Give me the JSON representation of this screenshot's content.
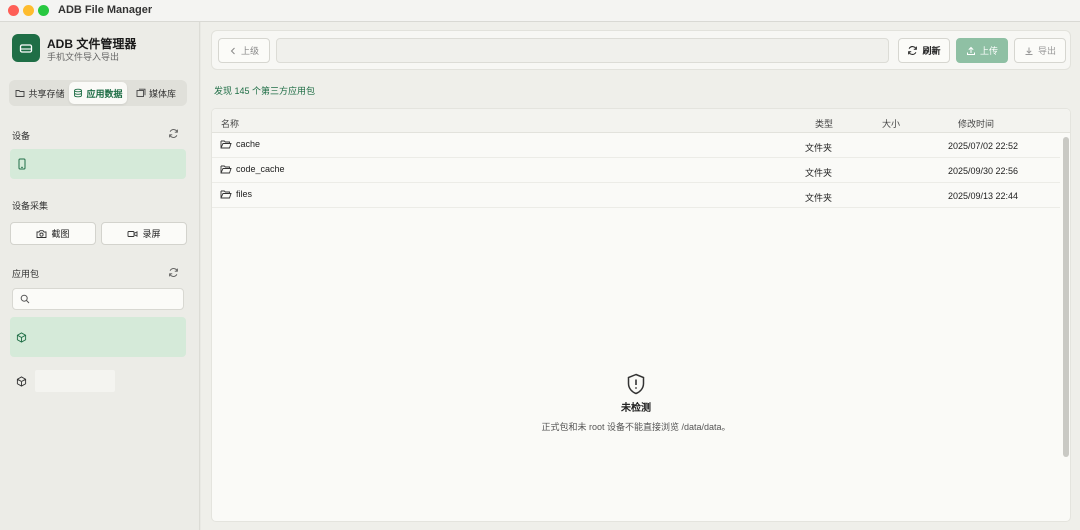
{
  "window": {
    "title": "ADB File Manager"
  },
  "app": {
    "title": "ADB 文件管理器",
    "subtitle": "手机文件导入导出"
  },
  "tabs": [
    {
      "label": "共享存储",
      "active": false
    },
    {
      "label": "应用数据",
      "active": true
    },
    {
      "label": "媒体库",
      "active": false
    }
  ],
  "sections": {
    "devices": "设备",
    "capture": "设备采集",
    "packages": "应用包"
  },
  "capture": {
    "screenshot": "截图",
    "record": "录屏"
  },
  "toolbar": {
    "up": "上级",
    "refresh": "刷新",
    "upload": "上传",
    "export": "导出",
    "path": ""
  },
  "status": "发现 145 个第三方应用包",
  "table": {
    "headers": {
      "name": "名称",
      "type": "类型",
      "size": "大小",
      "modified": "修改时间"
    },
    "rows": [
      {
        "name": "cache",
        "type": "文件夹",
        "size": "",
        "modified": "2025/07/02 22:52"
      },
      {
        "name": "code_cache",
        "type": "文件夹",
        "size": "",
        "modified": "2025/09/30 22:56"
      },
      {
        "name": "files",
        "type": "文件夹",
        "size": "",
        "modified": "2025/09/13 22:44"
      }
    ]
  },
  "empty": {
    "title": "未检测",
    "message": "正式包和未 root 设备不能直接浏览 /data/data。"
  },
  "colors": {
    "accent": "#1f6e46",
    "selected": "#d5ead9",
    "upload_disabled": "#8fc0a4"
  }
}
